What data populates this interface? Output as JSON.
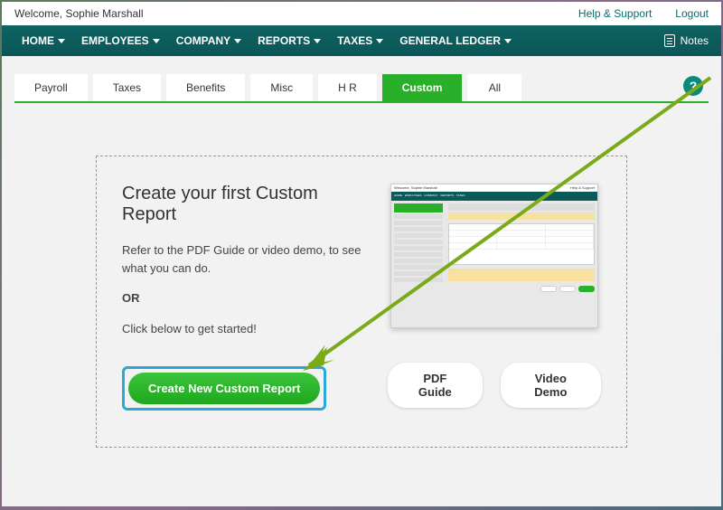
{
  "topbar": {
    "welcome": "Welcome, Sophie Marshall",
    "help": "Help & Support",
    "logout": "Logout"
  },
  "nav": {
    "items": [
      {
        "label": "HOME"
      },
      {
        "label": "EMPLOYEES"
      },
      {
        "label": "COMPANY"
      },
      {
        "label": "REPORTS"
      },
      {
        "label": "TAXES"
      },
      {
        "label": "GENERAL LEDGER"
      }
    ],
    "notes": "Notes"
  },
  "tabs": [
    {
      "label": "Payroll",
      "active": false
    },
    {
      "label": "Taxes",
      "active": false
    },
    {
      "label": "Benefits",
      "active": false
    },
    {
      "label": "Misc",
      "active": false
    },
    {
      "label": "H R",
      "active": false
    },
    {
      "label": "Custom",
      "active": true
    },
    {
      "label": "All",
      "active": false
    }
  ],
  "panel": {
    "heading": "Create your first Custom Report",
    "line1": "Refer to the PDF Guide or video demo, to see what you can do.",
    "or": "OR",
    "line2": "Click below to get started!",
    "cta": "Create New Custom Report",
    "pdf": "PDF Guide",
    "video": "Video Demo"
  },
  "colors": {
    "nav": "#0a5a5a",
    "accent_green": "#2aaf2a",
    "highlight_blue": "#2aa8d8"
  }
}
